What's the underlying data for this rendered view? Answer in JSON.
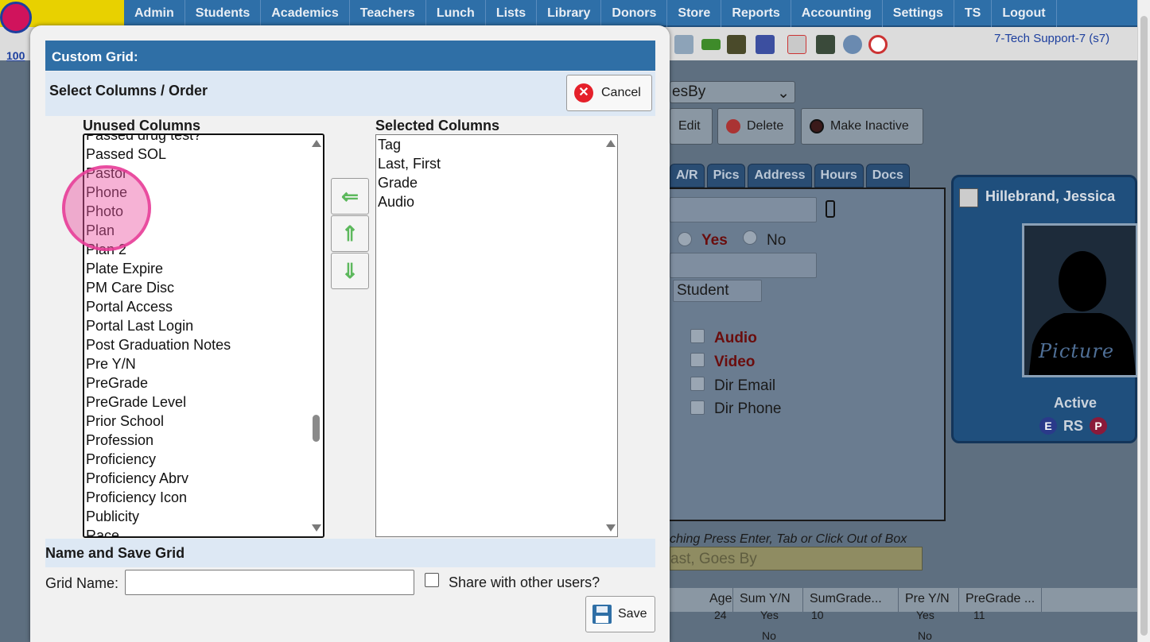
{
  "nav": {
    "logo_number": "100",
    "items": [
      "Admin",
      "Students",
      "Academics",
      "Teachers",
      "Lunch",
      "Lists",
      "Library",
      "Donors",
      "Store",
      "Reports",
      "Accounting",
      "Settings",
      "TS",
      "Logout"
    ]
  },
  "user_label": "7-Tech Support-7 (s7)",
  "background": {
    "sort_select_value": "esBy",
    "buttons": {
      "edit": "Edit",
      "delete": "Delete",
      "make_inactive": "Make Inactive"
    },
    "tabs": [
      "A/R",
      "Pics",
      "Address",
      "Hours",
      "Docs"
    ],
    "radio_yes": "Yes",
    "radio_no": "No",
    "type_select_value": "Student",
    "checks": [
      "Audio",
      "Video",
      "Dir Email",
      "Dir Phone"
    ],
    "student_name": "Hillebrand, Jessica",
    "photo_caption": "Picture",
    "status": "Active",
    "card_badges": [
      "E",
      "RS",
      "P"
    ],
    "search_hint": "ching Press Enter, Tab or Click Out of Box",
    "search_placeholder": "ast, Goes By",
    "grid_columns": [
      "Age",
      "Sum Y/N",
      "SumGrade...",
      "Pre Y/N",
      "PreGrade ..."
    ],
    "grid_row1": {
      "age": "24",
      "sum": "Yes",
      "sumgrade": "10",
      "pre": "Yes",
      "pregrade": "11"
    },
    "grid_row2": {
      "sum": "No",
      "pre": "No"
    }
  },
  "modal": {
    "title": "Custom Grid:",
    "section_columns": "Select Columns / Order",
    "cancel_label": "Cancel",
    "unused_label": "Unused Columns",
    "selected_label": "Selected Columns",
    "unused_items": [
      "Passed drug test?",
      "Passed SOL",
      "Pastor",
      "Phone",
      "Photo",
      "Plan",
      "Plan 2",
      "Plate Expire",
      "PM Care Disc",
      "Portal Access",
      "Portal Last Login",
      "Post Graduation Notes",
      "Pre Y/N",
      "PreGrade",
      "PreGrade Level",
      "Prior School",
      "Profession",
      "Proficiency",
      "Proficiency Abrv",
      "Proficiency Icon",
      "Publicity",
      "Race"
    ],
    "selected_items": [
      "Tag",
      "Last, First",
      "Grade",
      "Audio"
    ],
    "section_save": "Name and Save Grid",
    "grid_name_label": "Grid Name:",
    "grid_name_value": "",
    "share_label": "Share with other users?",
    "save_label": "Save"
  },
  "colors": {
    "title_bar": "#2f6fa6",
    "section_bg": "#dde8f4",
    "click_marker": "#ec54a2",
    "arrow": "#5cb85c"
  }
}
